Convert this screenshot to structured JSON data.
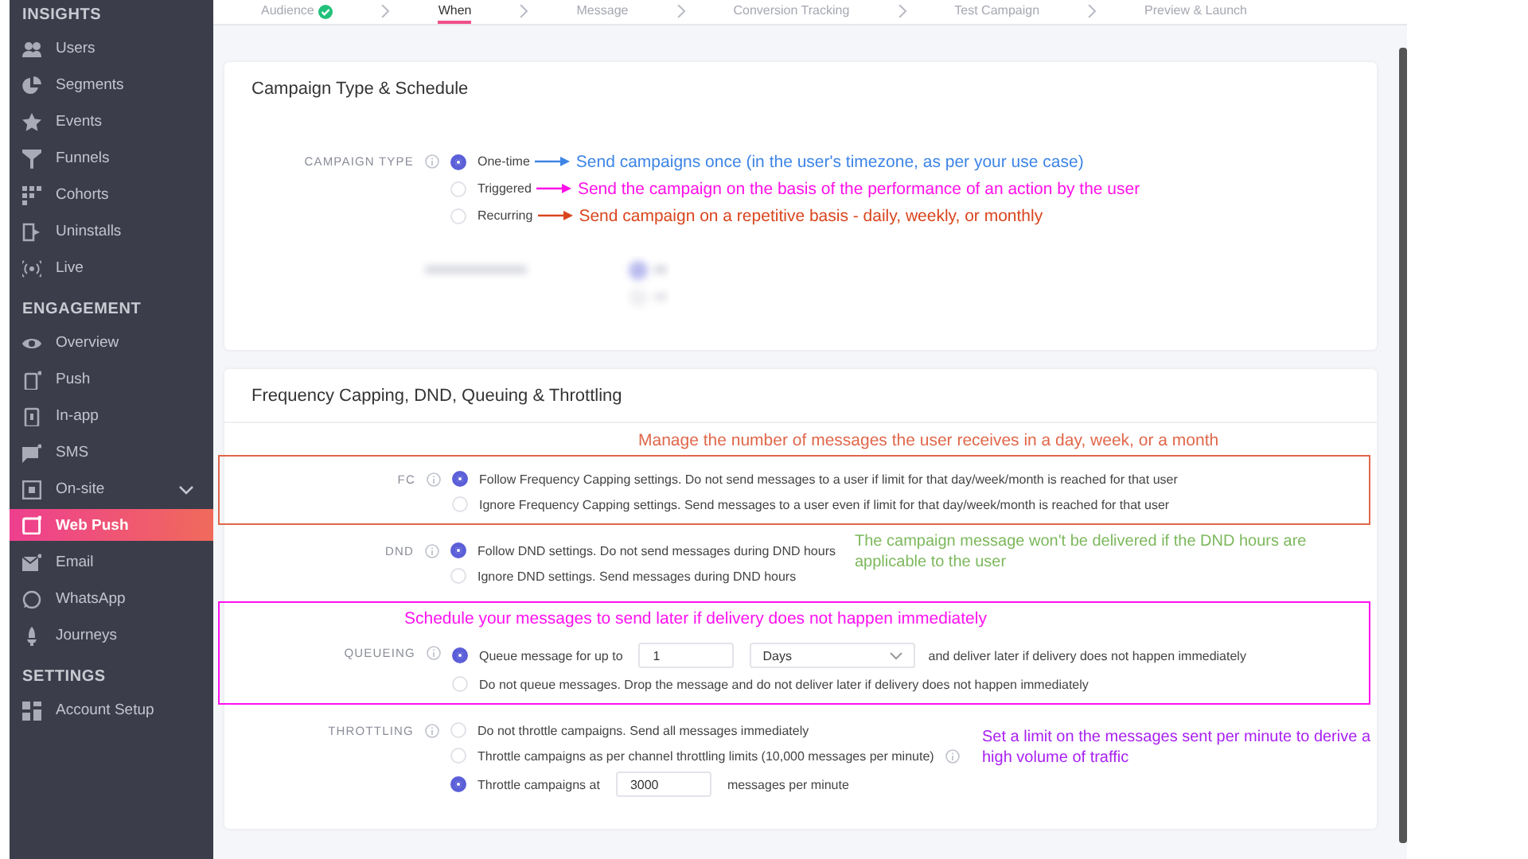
{
  "steps": [
    {
      "label": "Audience",
      "selected": false,
      "done": true
    },
    {
      "label": "When",
      "selected": true,
      "done": false
    },
    {
      "label": "Message",
      "selected": false,
      "done": false
    },
    {
      "label": "Conversion Tracking",
      "selected": false,
      "done": false
    },
    {
      "label": "Test Campaign",
      "selected": false,
      "done": false
    },
    {
      "label": "Preview & Launch",
      "selected": false,
      "done": false
    }
  ],
  "sidebar": {
    "sections": [
      {
        "title": "INSIGHTS",
        "items": [
          {
            "label": "Users",
            "selected": false
          },
          {
            "label": "Segments",
            "selected": false
          },
          {
            "label": "Events",
            "selected": false
          },
          {
            "label": "Funnels",
            "selected": false
          },
          {
            "label": "Cohorts",
            "selected": false
          },
          {
            "label": "Uninstalls",
            "selected": false
          },
          {
            "label": "Live",
            "selected": false
          }
        ]
      },
      {
        "title": "ENGAGEMENT",
        "items": [
          {
            "label": "Overview",
            "selected": false
          },
          {
            "label": "Push",
            "selected": false
          },
          {
            "label": "In-app",
            "selected": false
          },
          {
            "label": "SMS",
            "selected": false
          },
          {
            "label": "On-site",
            "selected": false,
            "expandable": true
          },
          {
            "label": "Web Push",
            "selected": true
          },
          {
            "label": "Email",
            "selected": false
          },
          {
            "label": "WhatsApp",
            "selected": false
          },
          {
            "label": "Journeys",
            "selected": false
          }
        ]
      },
      {
        "title": "SETTINGS",
        "items": [
          {
            "label": "Account Setup",
            "selected": false
          }
        ]
      }
    ]
  },
  "schedule_card": {
    "title": "Campaign Type & Schedule",
    "campaign_type": {
      "label": "CAMPAIGN TYPE",
      "options": [
        {
          "label": "One-time",
          "selected": true,
          "note": {
            "text": "Send campaigns once (in the user's timezone, as per your use case)",
            "color": "#3d85e6"
          }
        },
        {
          "label": "Triggered",
          "selected": false,
          "note": {
            "text": "Send the campaign on the basis of the performance of an action by the user",
            "color": "#ff10e8"
          }
        },
        {
          "label": "Recurring",
          "selected": false,
          "note": {
            "text": "Send campaign on a repetitive basis - daily, weekly, or monthly",
            "color": "#d9461e"
          }
        }
      ]
    }
  },
  "delivery_card": {
    "title": "Frequency Capping, DND, Queuing & Throttling",
    "settings": [
      {
        "label": "FC",
        "framed": true,
        "annotation": {
          "text": "Manage the number of messages the user receives in a day, week, or a month",
          "color": "#e0674a",
          "kind": "above"
        },
        "options": [
          {
            "kind": "text",
            "label": "Follow Frequency Capping settings. Do not send messages to a user if limit for that day/week/month is reached for that user",
            "selected": true
          },
          {
            "kind": "text",
            "label": "Ignore Frequency Capping settings. Send messages to a user even if limit for that day/week/month is reached for that user",
            "selected": false
          }
        ]
      },
      {
        "label": "DND",
        "annotation": {
          "text": "The campaign message won't be delivered if the DND hours are applicable to the user",
          "color": "#7cb85c",
          "kind": "beside"
        },
        "options": [
          {
            "kind": "text",
            "label": "Follow DND settings. Do not send messages during DND hours",
            "selected": true
          },
          {
            "kind": "text",
            "label": "Ignore DND settings. Send messages during DND hours",
            "selected": false
          }
        ]
      },
      {
        "label": "QUEUEING",
        "framed": true,
        "annotation": {
          "text": "Schedule your messages to send later if delivery does not happen immediately",
          "color": "#ff10f0",
          "kind": "inside"
        },
        "options": [
          {
            "kind": "input_select",
            "label": "Queue message for up to",
            "value": "1",
            "select": "Days",
            "after": "and deliver later if delivery does not happen immediately",
            "selected": true
          },
          {
            "kind": "text",
            "label": "Do not queue messages. Drop the message and do not deliver later if delivery does not happen immediately",
            "selected": false
          }
        ]
      },
      {
        "label": "THROTTLING",
        "annotation": {
          "text": "Set a limit on the messages sent per minute to derive a high volume of traffic",
          "color": "#a81ff0",
          "kind": "aside"
        },
        "options": [
          {
            "kind": "text",
            "label": "Do not throttle campaigns. Send all messages immediately",
            "selected": false
          },
          {
            "kind": "text",
            "label": "Throttle campaigns as per channel throttling limits (10,000 messages per minute)",
            "selected": false,
            "info": true
          },
          {
            "kind": "input",
            "label": "Throttle campaigns at",
            "value": "3000",
            "after": "messages per minute",
            "selected": true
          }
        ]
      }
    ]
  }
}
